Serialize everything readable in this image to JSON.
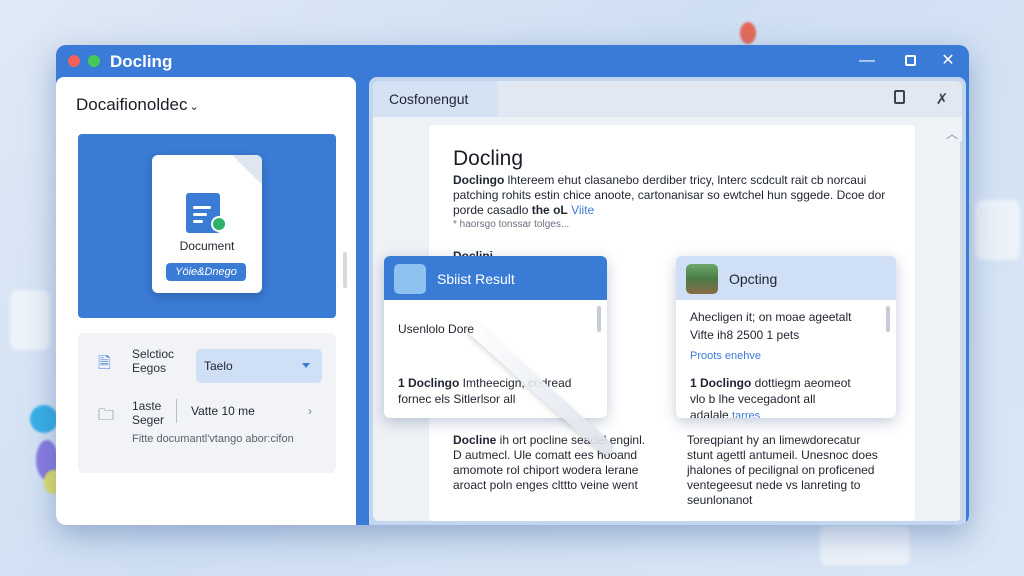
{
  "window": {
    "title": "Docling",
    "min_glyph": "—",
    "close_glyph": "✕"
  },
  "left_panel": {
    "header": "Docaifionoldec",
    "header_chevron": "⌄",
    "preview": {
      "doc_label": "Document",
      "doc_tag": "Yöie&Dnego"
    },
    "close_glyph": "✕",
    "settings": {
      "row1": {
        "label_line1": "Selctioc",
        "label_line2": "Eegos",
        "select_value": "Taelo"
      },
      "row2": {
        "label_line1": "1aste",
        "label_line2": "Seger",
        "value": "Vatte 10 me",
        "chevron": "›"
      },
      "note": "Fitte documantl'vtango abor:cifon"
    }
  },
  "right_panel": {
    "tab_label": "Cosfonengut",
    "tab_icon_b": "✗",
    "scroll_up": "︿",
    "page": {
      "title": "Docling",
      "para_bold": "Doclingo",
      "para_text": " lhtereem ehut clasanebo derdiber tricy, lnterc scdcult rait cb norcaui patching rohits estin chice anoote, cartonanisar so ewtchel hun sggede. Dcoe dor porde casadlo",
      "para_bold2": "the oL",
      "para_link": "Viite",
      "sub": "* haorsgo tonssar tolges...",
      "h2": "Doclini",
      "col_left_bold": "Docline",
      "col_left": " ih ort pocline seadel enginl. D autmecl. Ule comatt ees hooand amomote rol chiport wodera lerane aroact poln enges clttto veine went",
      "col_right": "Toreqpiant hy an limewdorecatur stunt agettl antumeil. Unesnoc does jhalones of pecilignal on proficened ventegeesut nede vs lanreting to seunlonanot"
    },
    "card_one": {
      "title": "Sbiist Result",
      "line1": "Usenlolo Dore",
      "line2_bold": "1 Doclingo",
      "line2": " Imtheecign, codread",
      "line3": "fornec els Sitlerlsor all"
    },
    "card_two": {
      "title": "Opcting",
      "line1": "Ahecligen it; on moae ageetalt",
      "line2": "Vifte ih8 2500 1 pets",
      "link": "Proots enehve",
      "line3_bold": "1 Doclingo",
      "line3": " dottiegm aeomeot",
      "line4": "vlo b lhe vecegadont all",
      "line5": "adalale ",
      "line5_link": "tarres"
    }
  }
}
